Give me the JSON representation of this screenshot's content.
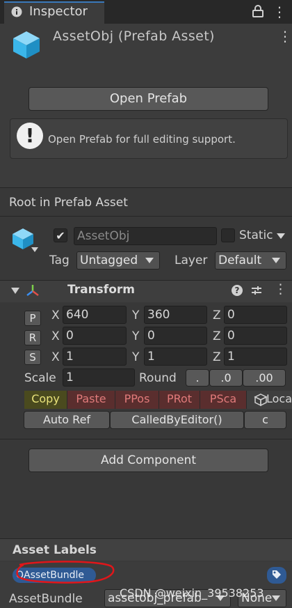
{
  "tab": {
    "title": "Inspector"
  },
  "header": {
    "title": "AssetObj (Prefab Asset)",
    "open_prefab": "Open Prefab",
    "help_icon": "!",
    "help_text": "Open Prefab for full editing support."
  },
  "root_label": "Root in Prefab Asset",
  "gameobject": {
    "name": "AssetObj",
    "static_label": "Static",
    "tag_label": "Tag",
    "tag_value": "Untagged",
    "layer_label": "Layer",
    "layer_value": "Default"
  },
  "transform": {
    "title": "Transform",
    "position": {
      "btn": "P",
      "x": "640",
      "y": "360",
      "z": "0"
    },
    "rotation": {
      "btn": "R",
      "x": "0",
      "y": "0",
      "z": "0"
    },
    "scale": {
      "btn": "S",
      "x": "1",
      "y": "1",
      "z": "1"
    },
    "axis_x": "X",
    "axis_y": "Y",
    "axis_z": "Z",
    "scale_label": "Scale",
    "scale_value": "1",
    "round_label": "Round",
    "round_options": [
      ".",
      ".0",
      ".00"
    ],
    "tools": [
      "Copy",
      "Paste",
      "PPos",
      "PRot",
      "PSca",
      "Loca"
    ],
    "auto_ref": "Auto Ref",
    "called_by_editor": "CalledByEditor()",
    "c_button": "c"
  },
  "add_component": "Add Component",
  "asset_labels": {
    "title": "Asset Labels",
    "label": "QAssetBundle",
    "assetbundle_label": "AssetBundle",
    "assetbundle_value": "assetobj_prefab",
    "variant_value": "None"
  },
  "watermark": "CSDN @weixin_39538253",
  "colors": {
    "background": "#383838",
    "accent_blue": "#3a79bb",
    "copy_yellow": "#4a4a1e",
    "tool_red": "#5a2e2e",
    "annotation_red": "#e0161a",
    "cube_blue": "#3bb6ea"
  }
}
